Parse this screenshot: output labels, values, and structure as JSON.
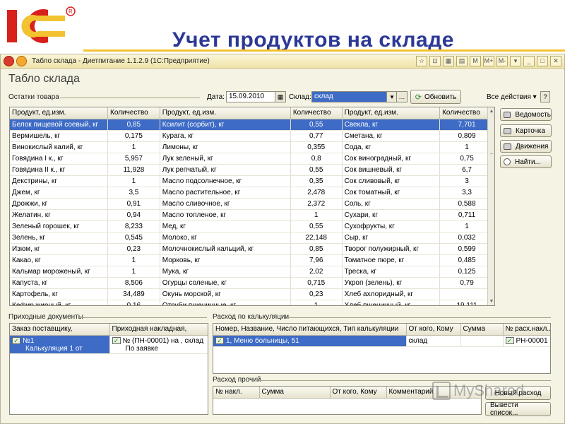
{
  "slide": {
    "title": "Учет продуктов на складе"
  },
  "window": {
    "title": "Табло склада - Диетпитание 1.1.2.9 (1С:Предприятие)",
    "controls": [
      "☆",
      "⊡",
      "▦",
      "▤",
      "M",
      "M+",
      "M-",
      "▾",
      "_",
      "□",
      "✕"
    ]
  },
  "form": {
    "title": "Табло склада"
  },
  "stock": {
    "group_label": "Остатки товара",
    "date_label": "Дата:",
    "date_value": "15.09.2010",
    "warehouse_label": "Склад:",
    "warehouse_value": "склад",
    "refresh_label": "Обновить",
    "all_actions_label": "Все действия ▾",
    "columns": [
      "Продукт, ед.изм.",
      "Количество",
      "Продукт, ед.изм.",
      "Количество",
      "Продукт, ед.изм.",
      "Количество"
    ],
    "rows": [
      [
        "Белок пищевой соевый, кг",
        "0,85",
        "Ксилит (сорбит), кг",
        "0,55",
        "Свекла, кг",
        "7,701"
      ],
      [
        "Вермишель, кг",
        "0,175",
        "Курага, кг",
        "0,77",
        "Сметана, кг",
        "0,809"
      ],
      [
        "Винокислый калий, кг",
        "1",
        "Лимоны, кг",
        "0,355",
        "Сода, кг",
        "1"
      ],
      [
        "Говядина I к., кг",
        "5,957",
        "Лук зеленый, кг",
        "0,8",
        "Сок виноградный, кг",
        "0,75"
      ],
      [
        "Говядина II к., кг",
        "11,928",
        "Лук репчатый, кг",
        "0,55",
        "Сок вишневый, кг",
        "6,7"
      ],
      [
        "Декстрины, кг",
        "1",
        "Масло подсолнечное, кг",
        "0,35",
        "Сок сливовый, кг",
        "3"
      ],
      [
        "Джем, кг",
        "3,5",
        "Масло растительное, кг",
        "2,478",
        "Сок томатный, кг",
        "3,3"
      ],
      [
        "Дрожжи, кг",
        "0,91",
        "Масло сливочное, кг",
        "2,372",
        "Соль, кг",
        "0,588"
      ],
      [
        "Желатин, кг",
        "0,94",
        "Масло топленое, кг",
        "1",
        "Сухари, кг",
        "0,711"
      ],
      [
        "Зеленый горошек, кг",
        "8,233",
        "Мед, кг",
        "0,55",
        "Сухофрукты, кг",
        "1"
      ],
      [
        "Зелень, кг",
        "0,545",
        "Молоко, кг",
        "22,148",
        "Сыр, кг",
        "0,032"
      ],
      [
        "Изюм, кг",
        "0,23",
        "Молочнокислый кальций, кг",
        "0,85",
        "Творог полужирный, кг",
        "0,599"
      ],
      [
        "Какао, кг",
        "1",
        "Морковь, кг",
        "7,96",
        "Томатное пюре, кг",
        "0,485"
      ],
      [
        "Кальмар мороженый, кг",
        "1",
        "Мука, кг",
        "2,02",
        "Треска, кг",
        "0,125"
      ],
      [
        "Капуста, кг",
        "8,506",
        "Огурцы соленые, кг",
        "0,715",
        "Укроп (зелень), кг",
        "0,79"
      ],
      [
        "Картофель, кг",
        "34,489",
        "Окунь морской, кг",
        "0,23",
        "Хлеб ахлоридный, кг",
        ""
      ],
      [
        "Кефир жирный, кг",
        "0,16",
        "Отруби пшеничные, кг",
        "1",
        "Хлеб пшеничный, кг",
        "19,111"
      ]
    ]
  },
  "side_buttons": [
    "Ведомость",
    "Карточка",
    "Движения",
    "Найти..."
  ],
  "incoming": {
    "group_label": "Приходные документы",
    "columns": [
      "Заказ поставщику,",
      "Приходная накладная,"
    ],
    "row": {
      "order_line1": "№1",
      "order_line2": "Калькуляция 1 от",
      "invoice_line1": "№ (ПН-00001) на , склад",
      "invoice_line2": "По заявке"
    }
  },
  "consumption": {
    "group_label": "Расход по калькуляции",
    "columns": [
      "Номер, Название, Число питающихся, Тип калькуляции",
      "От кого, Кому",
      "Сумма",
      "№ расх.накл..."
    ],
    "row": [
      "1, Меню больницы, 51",
      "склад",
      "",
      "РН-00001"
    ]
  },
  "other": {
    "group_label": "Расход прочий",
    "columns": [
      "№ накл.",
      "Сумма",
      "От кого, Кому",
      "Комментарий"
    ],
    "new_btn": "Новый расход",
    "export_btn": "Вывести список..."
  },
  "watermark": "MyShared"
}
